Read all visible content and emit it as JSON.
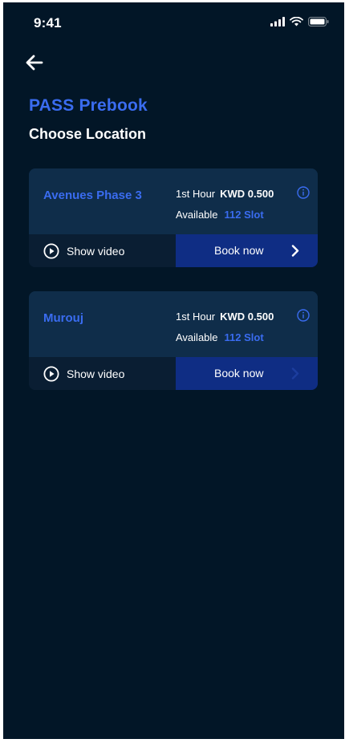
{
  "status_bar": {
    "time": "9:41"
  },
  "header": {
    "title": "PASS Prebook",
    "subtitle": "Choose Location"
  },
  "locations": [
    {
      "name": "Avenues Phase 3",
      "rate_label": "1st Hour",
      "rate_value": "KWD 0.500",
      "availability_label": "Available",
      "availability_value": "112 Slot",
      "video_label": "Show video",
      "book_label": "Book now"
    },
    {
      "name": "Murouj",
      "rate_label": "1st Hour",
      "rate_value": "KWD 0.500",
      "availability_label": "Available",
      "availability_value": "112 Slot",
      "video_label": "Show video",
      "book_label": "Book now"
    }
  ],
  "icons": {
    "back": "arrow-left-icon",
    "info": "info-icon",
    "play": "play-circle-icon",
    "chevron": "chevron-right-icon",
    "signal": "signal-icon",
    "wifi": "wifi-icon",
    "battery": "battery-icon"
  },
  "colors": {
    "background": "#021627",
    "accent": "#3a6cf0",
    "card_top": "#0f2d4a",
    "card_bottom": "#0a1e33",
    "book_button": "#0f2d84"
  }
}
